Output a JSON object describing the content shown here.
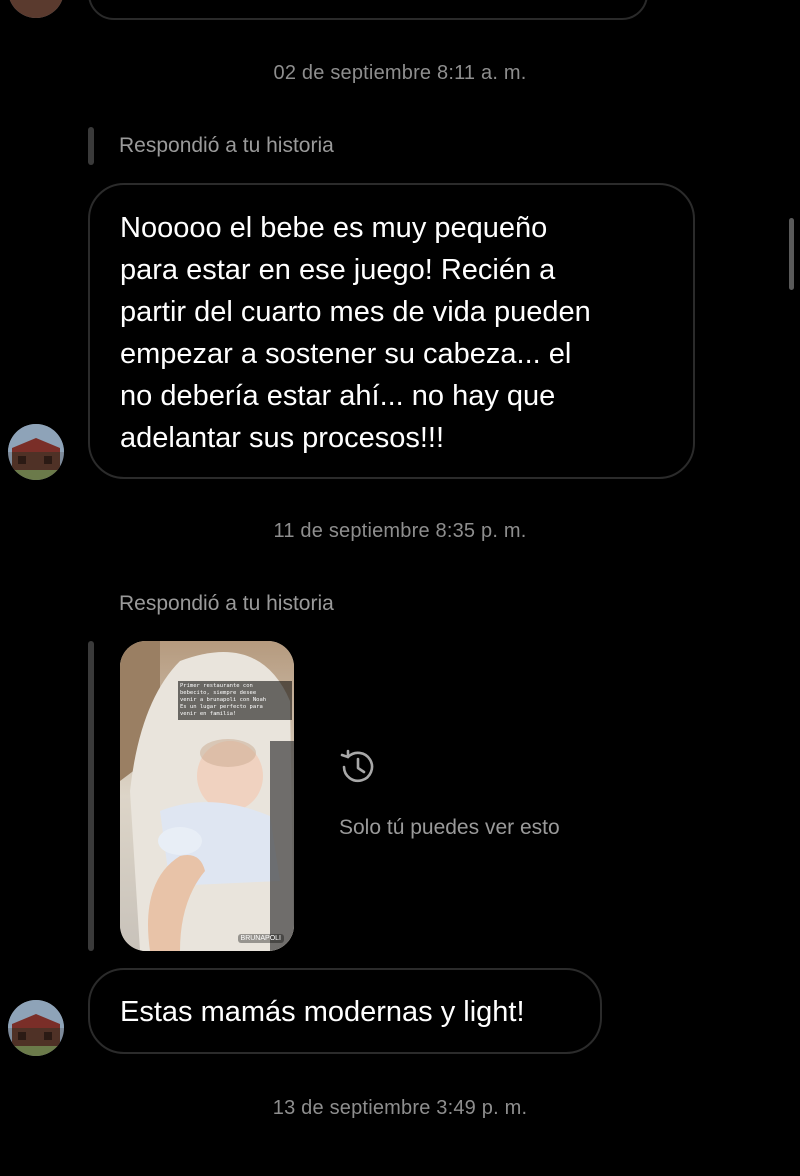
{
  "conversation": {
    "timestamps": [
      "02 de septiembre 8:11 a. m.",
      "11 de septiembre 8:35 p. m.",
      "13 de septiembre 3:49 p. m."
    ],
    "messages": [
      {
        "reply_label": "Respondió a tu historia",
        "lines": [
          "Nooooo el bebe es muy pequeño",
          "para estar en ese juego! Recién a",
          "partir del cuarto mes de vida pueden",
          "empezar a sostener su cabeza... el",
          "no debería estar ahí... no hay que",
          "adelantar sus procesos!!!"
        ]
      },
      {
        "reply_label": "Respondió a tu historia",
        "story": {
          "caption_lines": [
            "Primer restaurante con",
            "bebecito, siempre desee",
            "venir a brunapoli con Noah",
            "Es un lugar perfecto para",
            "venir en familia!"
          ],
          "handle": "BRUNAPOLI"
        },
        "only_you_text": "Solo tú puedes ver esto",
        "text": "Estas mamás modernas y light!"
      }
    ]
  },
  "colors": {
    "background": "#000000",
    "bubble_border": "#2b2b2b",
    "secondary_text": "#8e8e8e"
  },
  "icons": {
    "history": "history-icon",
    "avatar": "avatar"
  }
}
